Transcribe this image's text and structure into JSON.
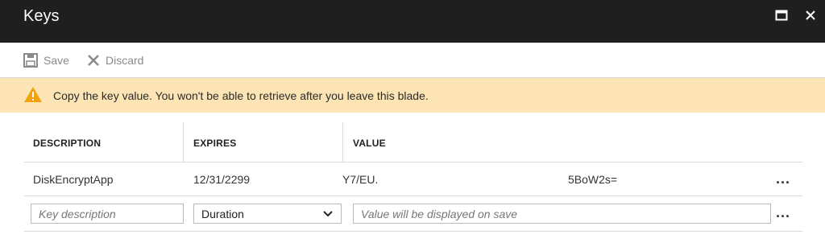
{
  "window": {
    "title": "Keys"
  },
  "toolbar": {
    "save_label": "Save",
    "discard_label": "Discard"
  },
  "warning": {
    "text": "Copy the key value. You won't be able to retrieve after you leave this blade."
  },
  "table": {
    "columns": [
      "DESCRIPTION",
      "EXPIRES",
      "VALUE"
    ],
    "rows": [
      {
        "description": "DiskEncryptApp",
        "expires": "12/31/2299",
        "value_start": "Y7/EU.",
        "value_end": "5BoW2s=",
        "more": "..."
      }
    ],
    "new_key": {
      "description_placeholder": "Key description",
      "duration_selected": "Duration",
      "value_placeholder": "Value will be displayed on save",
      "more": "..."
    }
  },
  "colors": {
    "titlebar": "#1f1f1f",
    "warning_bg": "#fce4b4",
    "warning_icon": "#f0a30a"
  }
}
